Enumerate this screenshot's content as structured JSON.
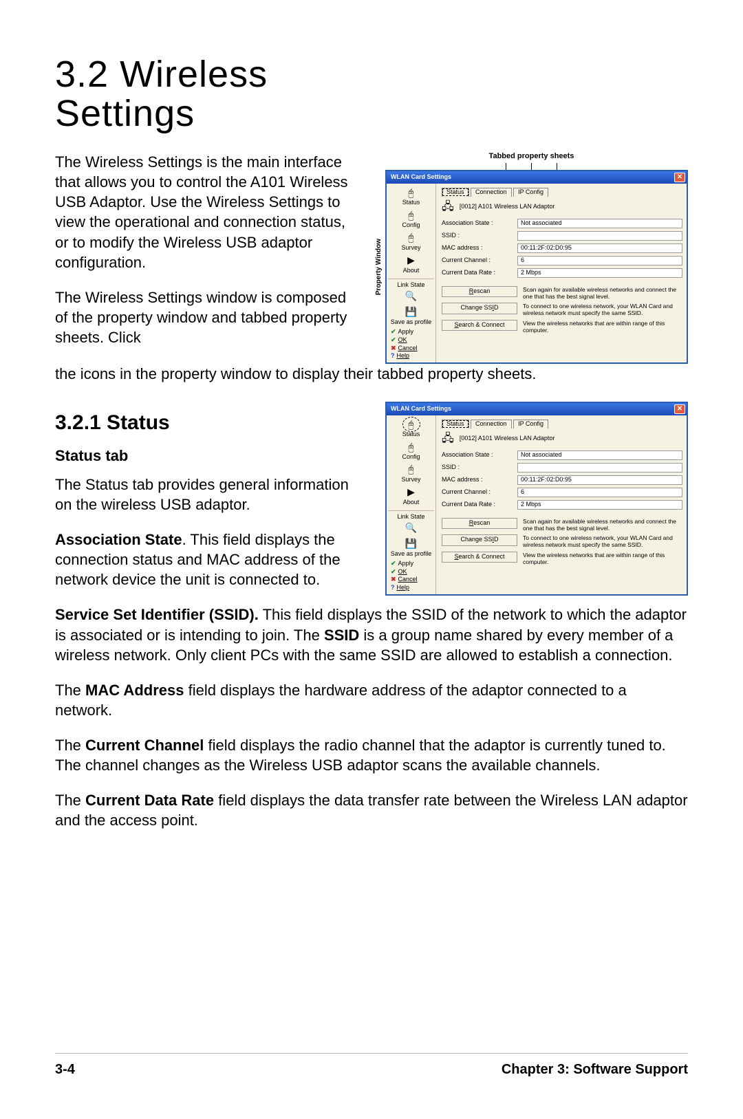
{
  "title_line1": "3.2 Wireless",
  "title_line2": "Settings",
  "intro_p1": "The Wireless Settings is the main interface that allows you  to control the A101 Wireless USB Adaptor. Use the Wireless Settings to view the operational and connection status, or to modify the Wireless USB adaptor configuration.",
  "intro_p2a": "The Wireless Settings window is composed of the property window and tabbed property sheets. Click",
  "intro_p2b": "the icons in the property window to display their tabbed property sheets.",
  "sub_heading": "3.2.1   Status",
  "sub_sub_heading": "Status tab",
  "status_p1": "The Status tab provides general information on the wireless USB adaptor.",
  "assoc_bold": "Association State",
  "assoc_rest": ". This field displays the connection status and MAC address of the network device the unit is connected to.",
  "ssid_bold": "Service Set Identifier (SSID).",
  "ssid_rest": " This field displays the SSID of the network to which the adaptor is associated or is intending to join. The ",
  "ssid_bold2": "SSID",
  "ssid_rest2": " is a group name shared by every member of a wireless network. Only client PCs with the same SSID are allowed to establish a connection.",
  "mac_pre": "The ",
  "mac_bold": "MAC Address",
  "mac_rest": " field displays the hardware address of the adaptor connected to a network.",
  "chan_pre": "The ",
  "chan_bold": "Current Channel",
  "chan_rest": " field displays the radio channel that the adaptor is currently tuned to. The channel changes as the Wireless USB adaptor scans the available channels.",
  "rate_pre": "The ",
  "rate_bold": "Current Data Rate",
  "rate_rest": " field displays the data transfer rate between the Wireless LAN adaptor and the access point.",
  "footer_left": "3-4",
  "footer_right": "Chapter 3: Software Support",
  "shot_label_tabs": "Tabbed property sheets",
  "shot_label_prop": "Property Window",
  "wlan": {
    "title": "WLAN Card Settings",
    "adaptor": "[0012] A101 Wireless LAN Adaptor",
    "tabs": {
      "status": "Status",
      "connection": "Connection",
      "ipconfig": "IP Config"
    },
    "side": {
      "status": "Status",
      "config": "Config",
      "survey": "Survey",
      "about": "About",
      "linkstate": "Link State",
      "saveprofile": "Save as profile",
      "apply": "Apply",
      "ok": "OK",
      "cancel": "Cancel",
      "help": "Help"
    },
    "fields": {
      "assoc_k": "Association State :",
      "assoc_v": "Not associated",
      "ssid_k": "SSID :",
      "ssid_v": "",
      "mac_k": "MAC address :",
      "mac_v": "00:11:2F:02:D0:95",
      "chan_k": "Current Channel :",
      "chan_v": "6",
      "rate_k": "Current Data Rate :",
      "rate_v": "2 Mbps"
    },
    "buttons": {
      "rescan": "Rescan",
      "rescan_desc": "Scan again for available wireless networks and connect the one that has the best signal level.",
      "change_ssid": "Change SSID",
      "change_ssid_desc": "To connect to one wireless network, your WLAN Card and wireless network must specify the same SSID.",
      "search": "Search & Connect",
      "search_desc": "View the wireless networks that are within range of this computer."
    }
  }
}
